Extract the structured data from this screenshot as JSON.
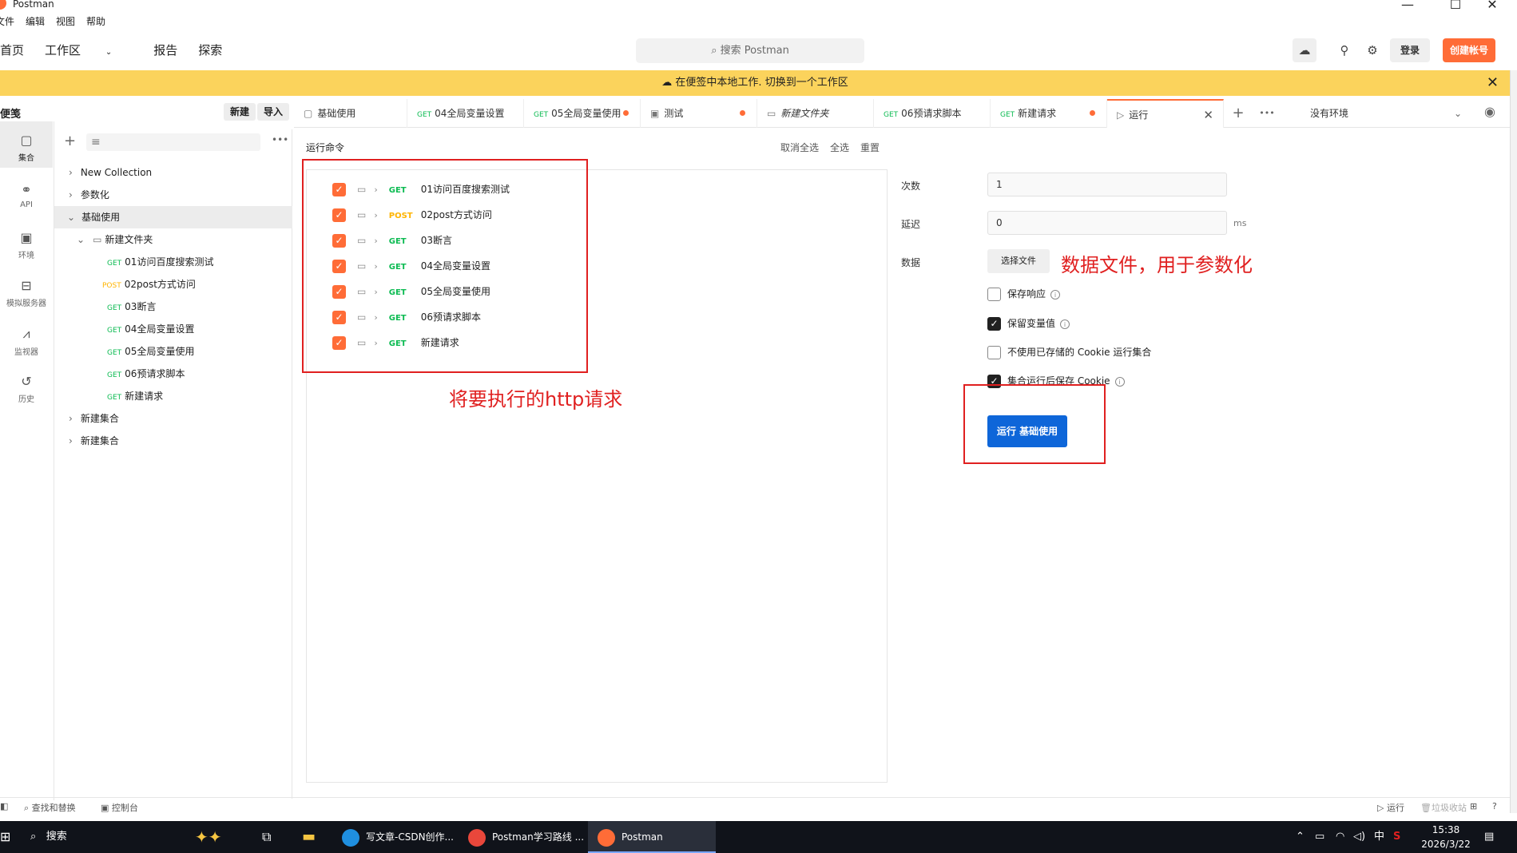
{
  "window": {
    "app_name": "Postman",
    "minimize": "—",
    "maximize": "☐",
    "close": "✕"
  },
  "menubar": {
    "items": [
      "文件",
      "编辑",
      "视图",
      "帮助"
    ]
  },
  "topnav": {
    "home": "首页",
    "workspace": "工作区",
    "reports": "报告",
    "explore": "探索"
  },
  "search": {
    "placeholder": "搜索 Postman"
  },
  "header": {
    "login": "登录",
    "signup": "创建帐号"
  },
  "banner": {
    "text": "在便签中本地工作.",
    "link": "切换到一个工作区"
  },
  "leftrail": {
    "items": [
      "集合",
      "API",
      "环境",
      "模拟服务器",
      "监视器",
      "历史"
    ]
  },
  "sidebar": {
    "title": "便笺",
    "new_button": "新建",
    "import_button": "导入",
    "tree": [
      {
        "label": "New Collection"
      },
      {
        "label": "参数化"
      },
      {
        "label": "基础使用"
      },
      {
        "label": "新建文件夹"
      },
      {
        "method": "GET",
        "label": "01访问百度搜索测试"
      },
      {
        "method": "POST",
        "label": "02post方式访问"
      },
      {
        "method": "GET",
        "label": "03断言"
      },
      {
        "method": "GET",
        "label": "04全局变量设置"
      },
      {
        "method": "GET",
        "label": "05全局变量使用"
      },
      {
        "method": "GET",
        "label": "06预请求脚本"
      },
      {
        "method": "GET",
        "label": "新建请求"
      },
      {
        "label": "新建集合"
      },
      {
        "label": "新建集合"
      }
    ]
  },
  "tabs": [
    {
      "label": "基础使用"
    },
    {
      "method": "GET",
      "label": "04全局变量设置"
    },
    {
      "method": "GET",
      "label": "05全局变量使用"
    },
    {
      "label": "测试"
    },
    {
      "label": "新建文件夹"
    },
    {
      "method": "GET",
      "label": "06预请求脚本"
    },
    {
      "method": "GET",
      "label": "新建请求"
    },
    {
      "label": "运行"
    }
  ],
  "environment": {
    "selected": "没有环境"
  },
  "runner": {
    "order_title": "运行命令",
    "deselect_all": "取消全选",
    "select_all": "全选",
    "reset": "重置",
    "requests": [
      {
        "method": "GET",
        "label": "01访问百度搜索测试"
      },
      {
        "method": "POST",
        "label": "02post方式访问"
      },
      {
        "method": "GET",
        "label": "03断言"
      },
      {
        "method": "GET",
        "label": "04全局变量设置"
      },
      {
        "method": "GET",
        "label": "05全局变量使用"
      },
      {
        "method": "GET",
        "label": "06预请求脚本"
      },
      {
        "method": "GET",
        "label": "新建请求"
      }
    ],
    "iterations_label": "次数",
    "iterations_value": "1",
    "delay_label": "延迟",
    "delay_value": "0",
    "delay_unit": "ms",
    "data_label": "数据",
    "choose_file": "选择文件",
    "options": [
      {
        "label": "保存响应",
        "checked": false
      },
      {
        "label": "保留变量值",
        "checked": true
      },
      {
        "label": "不使用已存储的 Cookie 运行集合",
        "checked": false
      },
      {
        "label": "集合运行后保存 Cookie",
        "checked": true
      }
    ],
    "run_button": "运行 基础使用"
  },
  "annotations": {
    "requests_note": "将要执行的http请求",
    "data_note": "数据文件，用于参数化"
  },
  "statusbar": {
    "find_replace": "查找和替换",
    "console": "控制台",
    "runner": "运行",
    "trash": "垃圾收站"
  },
  "taskbar": {
    "search": "搜索",
    "apps": [
      "写文章-CSDN创作...",
      "Postman学习路线 ...",
      "Postman"
    ],
    "ime": "中",
    "time": "15:38",
    "date": "2026/3/22"
  },
  "colors": {
    "accent": "#ff6c37",
    "run_button": "#0e66d9",
    "banner": "#fbd35c",
    "annotation": "#e02020",
    "get": "#0cbb52",
    "post": "#ffb400"
  }
}
